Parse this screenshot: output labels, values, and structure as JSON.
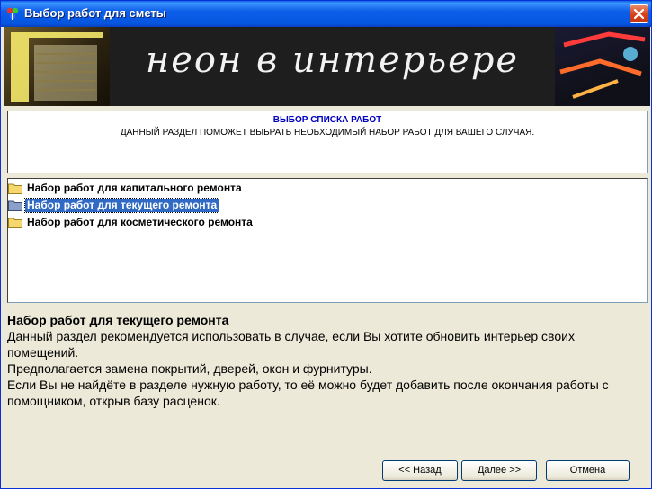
{
  "window": {
    "title": "Выбор работ для сметы"
  },
  "banner": {
    "title": "неон в интерьере"
  },
  "info": {
    "heading": "ВЫБОР СПИСКА РАБОТ",
    "text": "ДАННЫЙ РАЗДЕЛ ПОМОЖЕТ ВЫБРАТЬ НЕОБХОДИМЫЙ НАБОР РАБОТ ДЛЯ ВАШЕГО СЛУЧАЯ."
  },
  "tree": {
    "items": [
      {
        "label": "Набор работ для капитального ремонта",
        "selected": false
      },
      {
        "label": "Набор работ для текущего ремонта",
        "selected": true
      },
      {
        "label": "Набор работ для косметического ремонта",
        "selected": false
      }
    ]
  },
  "description": {
    "title": "Набор работ для текущего ремонта",
    "paragraph1": "Данный раздел рекомендуется использовать в случае, если Вы хотите обновить интерьер своих помещений.",
    "paragraph2": "Предполагается замена покрытий, дверей, окон и фурнитуры.",
    "paragraph3": "Если Вы не найдёте в разделе нужную работу, то её можно будет добавить после окончания работы с помощником, открыв базу расценок."
  },
  "buttons": {
    "back": "<< Назад",
    "next": "Далее >>",
    "cancel": "Отмена"
  },
  "colors": {
    "titlebar": "#0555e0",
    "selection": "#316ac5",
    "info_heading": "#0000c0"
  }
}
